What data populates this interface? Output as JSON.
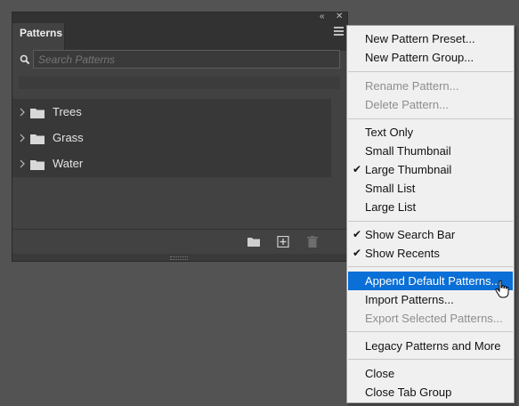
{
  "panel": {
    "collapse_glyph": "«",
    "close_glyph": "✕",
    "tab_title": "Patterns",
    "search_placeholder": "Search Patterns",
    "items": [
      {
        "label": "Trees",
        "icon": "folder-icon"
      },
      {
        "label": "Grass",
        "icon": "folder-icon"
      },
      {
        "label": "Water",
        "icon": "folder-icon"
      }
    ],
    "footer_icons": [
      "new-group-folder-icon",
      "new-pattern-icon",
      "trash-icon"
    ]
  },
  "menu": {
    "group1": [
      "New Pattern Preset...",
      "New Pattern Group..."
    ],
    "group2_disabled": [
      "Rename Pattern...",
      "Delete Pattern..."
    ],
    "group3": [
      "Text Only",
      "Small Thumbnail",
      "Large Thumbnail",
      "Small List",
      "Large List"
    ],
    "group3_checked": "Large Thumbnail",
    "group4": [
      "Show Search Bar",
      "Show Recents"
    ],
    "group5": [
      "Append Default Patterns...",
      "Import Patterns...",
      "Export Selected Patterns..."
    ],
    "highlighted": "Append Default Patterns...",
    "disabled_export": "Export Selected Patterns...",
    "group6": [
      "Legacy Patterns and More"
    ],
    "group7": [
      "Close",
      "Close Tab Group"
    ],
    "check_glyph": "✔"
  },
  "colors": {
    "background": "#535353",
    "panel": "#424242",
    "menu": "#f0f0f0",
    "highlight": "#0a6fd6"
  }
}
